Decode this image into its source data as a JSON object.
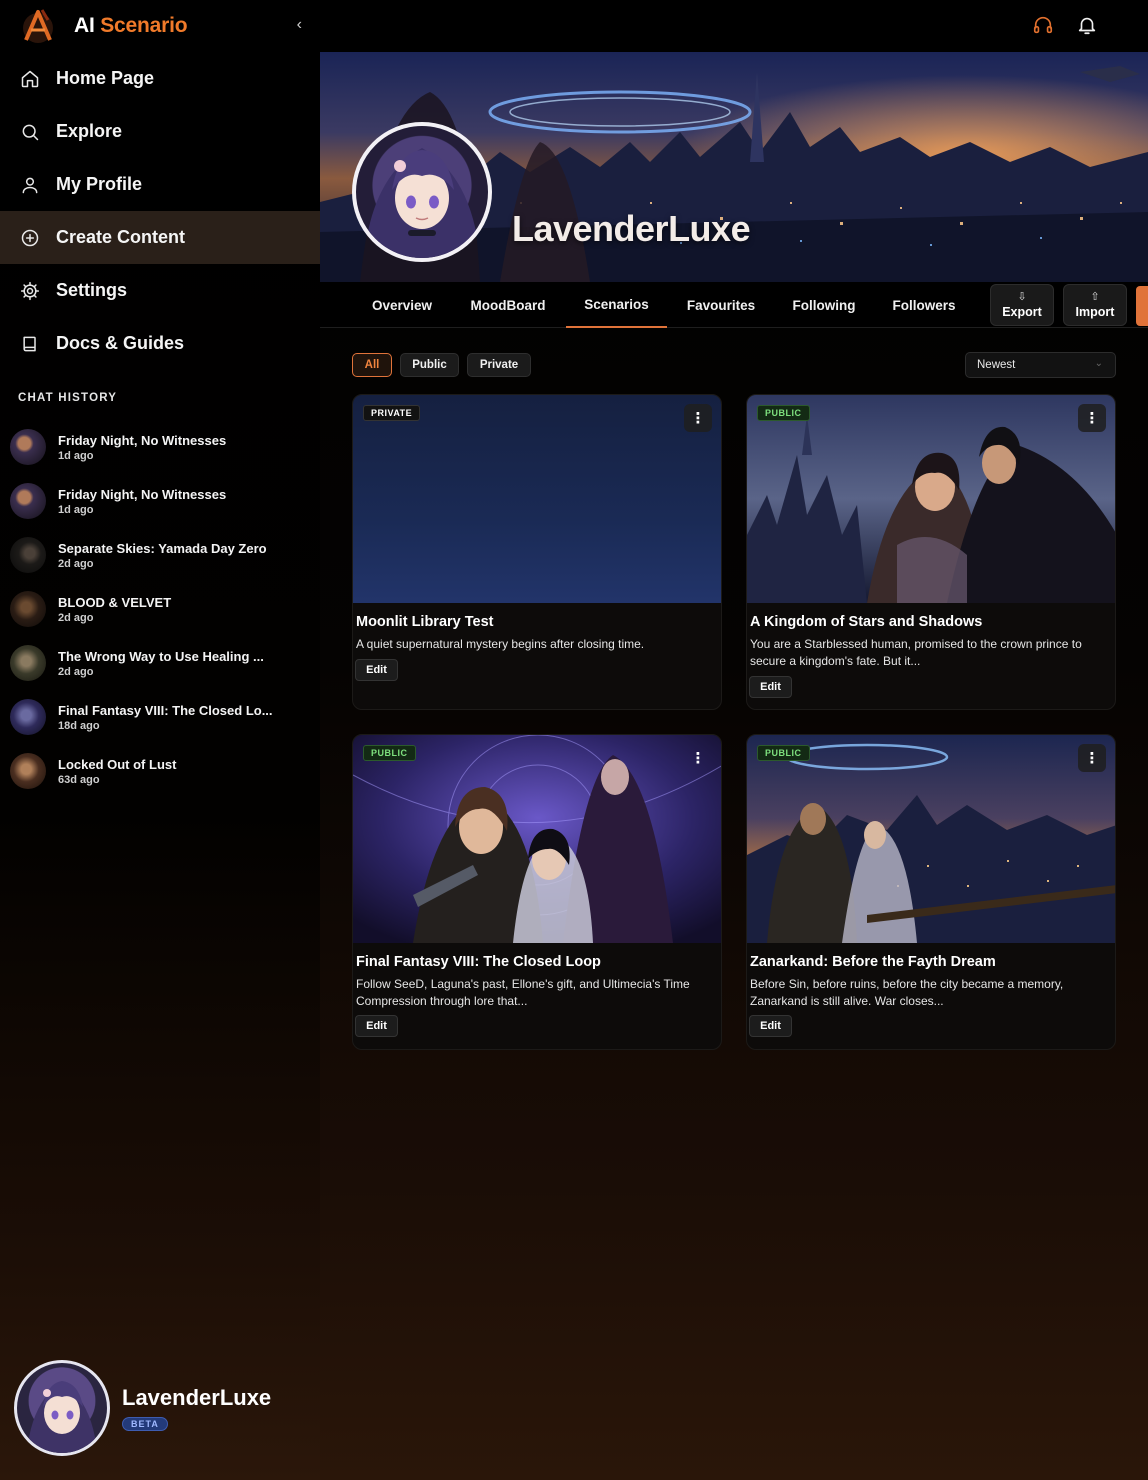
{
  "brand": {
    "ai": "AI",
    "scenario": "Scenario",
    "collapse_glyph": "‹"
  },
  "nav": [
    {
      "label": "Home Page",
      "icon": "home-icon"
    },
    {
      "label": "Explore",
      "icon": "search-icon"
    },
    {
      "label": "My Profile",
      "icon": "user-icon"
    },
    {
      "label": "Create Content",
      "icon": "plus-circle-icon",
      "active": true
    },
    {
      "label": "Settings",
      "icon": "gear-icon"
    },
    {
      "label": "Docs & Guides",
      "icon": "book-icon"
    }
  ],
  "history": {
    "title": "CHAT HISTORY",
    "items": [
      {
        "title": "Friday Night, No Witnesses",
        "time": "1d ago"
      },
      {
        "title": "Friday Night, No Witnesses",
        "time": "1d ago"
      },
      {
        "title": "Separate Skies: Yamada Day Zero",
        "time": "2d ago"
      },
      {
        "title": "BLOOD & VELVET",
        "time": "2d ago"
      },
      {
        "title": "The Wrong Way to Use Healing ...",
        "time": "2d ago"
      },
      {
        "title": "Final Fantasy VIII: The Closed Lo...",
        "time": "18d ago"
      },
      {
        "title": "Locked Out of Lust",
        "time": "63d ago"
      }
    ]
  },
  "user": {
    "name": "LavenderLuxe",
    "badge": "BETA"
  },
  "profile": {
    "name": "LavenderLuxe"
  },
  "tabs": [
    "Overview",
    "MoodBoard",
    "Scenarios",
    "Favourites",
    "Following",
    "Followers"
  ],
  "active_tab": "Scenarios",
  "tools": {
    "export_label": "Export",
    "export_glyph": "⇩",
    "import_label": "Import",
    "import_glyph": "⇧"
  },
  "filters": {
    "all": "All",
    "public": "Public",
    "private": "Private",
    "active": "All"
  },
  "sort": {
    "value": "Newest",
    "chev": "⌄"
  },
  "cards": [
    {
      "visibility": "PRIVATE",
      "title": "Moonlit Library Test",
      "desc": "A quiet supernatural mystery begins after closing time.",
      "edit": "Edit"
    },
    {
      "visibility": "PUBLIC",
      "title": "A Kingdom of Stars and Shadows",
      "desc": "You are a Starblessed human, promised to the crown prince to secure a kingdom's fate. But it...",
      "edit": "Edit"
    },
    {
      "visibility": "PUBLIC",
      "title": "Final Fantasy VIII: The Closed Loop",
      "desc": "Follow SeeD, Laguna's past, Ellone's gift, and Ultimecia's Time Compression through lore that...",
      "edit": "Edit"
    },
    {
      "visibility": "PUBLIC",
      "title": "Zanarkand: Before the Fayth Dream",
      "desc": "Before Sin, before ruins, before the city became a memory, Zanarkand is still alive. War closes...",
      "edit": "Edit"
    }
  ],
  "kebab_glyph": "⋮",
  "colors": {
    "accent": "#f07a2a",
    "active_nav": "#2a2019",
    "public_badge": "#7ee07e"
  }
}
